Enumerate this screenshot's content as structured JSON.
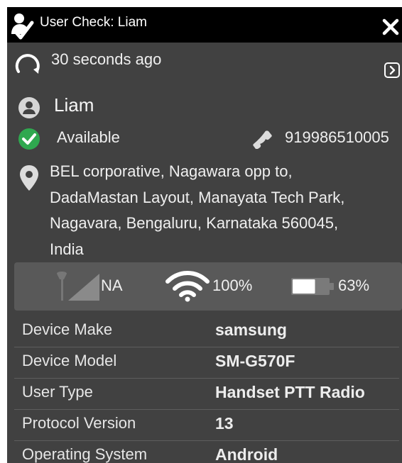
{
  "header": {
    "title": "User Check: Liam",
    "icon": "user-check-icon",
    "close_icon": "close-icon"
  },
  "refresh": {
    "icon": "refresh-icon",
    "last_updated": "30 seconds ago",
    "expand_icon": "chevron-right-icon"
  },
  "user": {
    "name": "Liam",
    "avatar_icon": "user-avatar-icon",
    "status": "Available",
    "status_icon": "check-circle-icon",
    "status_color": "#2fa84f",
    "phone_icon": "phone-icon",
    "phone": "919986510005",
    "location_icon": "map-pin-icon",
    "address_lines": [
      "BEL corporative, Nagawara opp to,",
      "DadaMastan Layout, Manayata Tech Park,",
      "Nagavara, Bengaluru, Karnataka 560045,",
      "India"
    ]
  },
  "network": {
    "signal_icon": "cell-signal-icon",
    "signal": "NA",
    "wifi_icon": "wifi-icon",
    "wifi": "100%",
    "battery_icon": "battery-icon",
    "battery": "63%",
    "battery_level": 0.63
  },
  "details": [
    {
      "label": "Device Make",
      "value": "samsung"
    },
    {
      "label": "Device Model",
      "value": "SM-G570F"
    },
    {
      "label": "User Type",
      "value": "Handset PTT Radio"
    },
    {
      "label": "Protocol Version",
      "value": "13"
    },
    {
      "label": "Operating System",
      "value": "Android"
    }
  ],
  "colors": {
    "panel_background": "#414141",
    "title_bar": "#000000",
    "network_strip": "#595959"
  }
}
